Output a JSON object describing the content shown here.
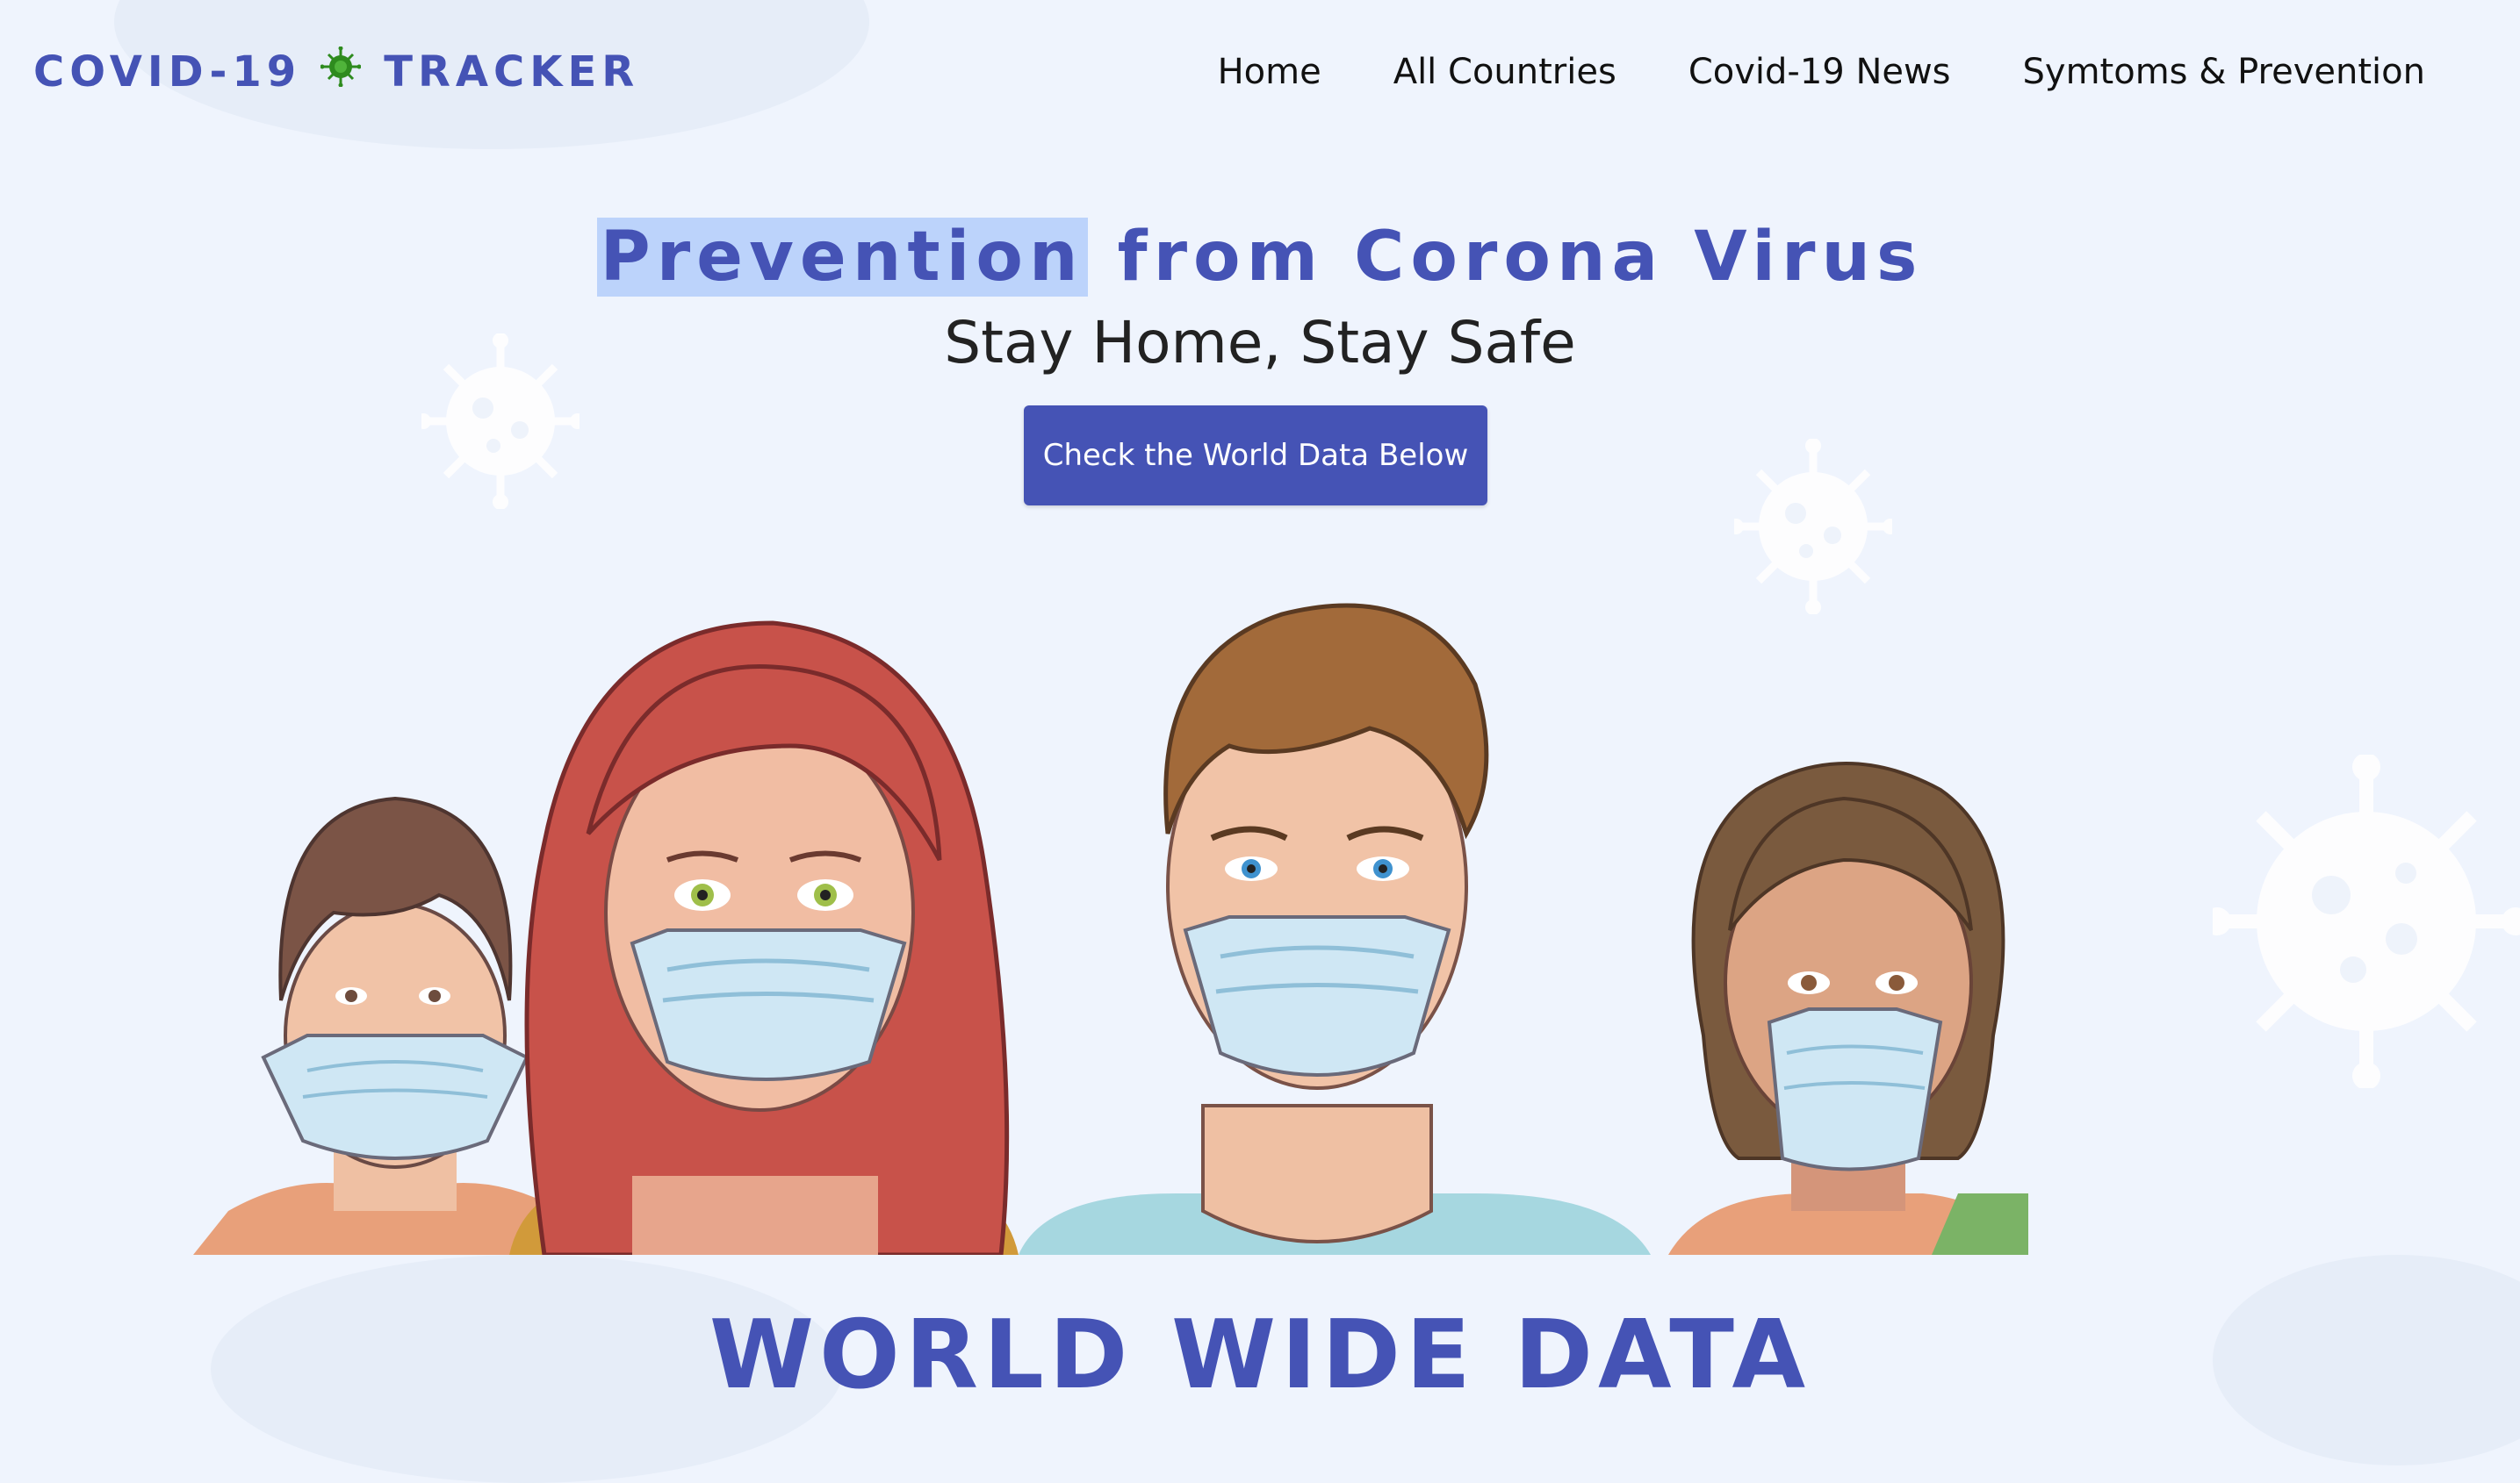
{
  "brand": {
    "text_left": "COVID-19",
    "text_right": "TRACKER",
    "logo_icon": "virus-icon",
    "logo_color": "#2e8b1e"
  },
  "nav": {
    "items": [
      {
        "label": "Home"
      },
      {
        "label": "All Countries"
      },
      {
        "label": "Covid-19 News"
      },
      {
        "label": "Symtoms & Prevention"
      }
    ]
  },
  "hero": {
    "title_highlight": "Prevention",
    "title_rest": " from Corona Virus",
    "subtitle": "Stay Home, Stay Safe",
    "cta_label": "Check the World Data Below",
    "illustration": "four-people-wearing-masks"
  },
  "section": {
    "title": "WORLD WIDE DATA"
  },
  "colors": {
    "accent": "#4553b5",
    "background": "#eff4fd",
    "highlight": "#bcd3fb"
  }
}
